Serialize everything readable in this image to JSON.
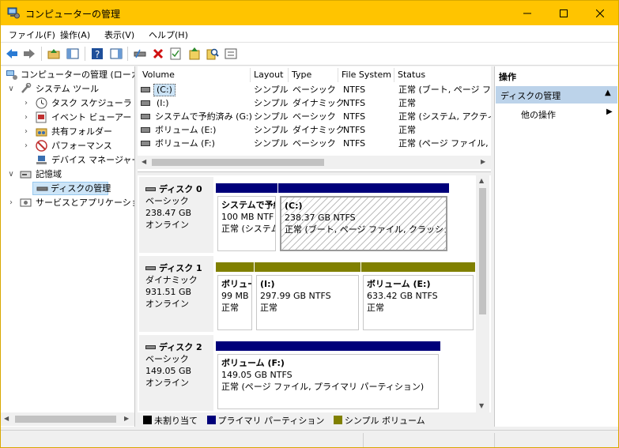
{
  "window": {
    "title": "コンピューターの管理"
  },
  "menu": {
    "file": "ファイル(F)",
    "action": "操作(A)",
    "view": "表示(V)",
    "help": "ヘルプ(H)"
  },
  "tree": {
    "root": "コンピューターの管理 (ローカル)",
    "system_tools": "システム ツール",
    "task_scheduler": "タスク スケジューラ",
    "event_viewer": "イベント ビューアー",
    "shared_folders": "共有フォルダー",
    "performance": "パフォーマンス",
    "device_manager": "デバイス マネージャー",
    "storage": "記憶域",
    "disk_management": "ディスクの管理",
    "services_apps": "サービスとアプリケーション"
  },
  "volumes": {
    "headers": [
      "Volume",
      "Layout",
      "Type",
      "File System",
      "Status"
    ],
    "rows": [
      [
        "(C:)",
        "シンプル",
        "ベーシック",
        "NTFS",
        "正常 (ブート, ページ ファイ"
      ],
      [
        "(I:)",
        "シンプル",
        "ダイナミック",
        "NTFS",
        "正常"
      ],
      [
        "システムで予約済み (G:)",
        "シンプル",
        "ベーシック",
        "NTFS",
        "正常 (システム, アクティブ"
      ],
      [
        "ボリューム (E:)",
        "シンプル",
        "ダイナミック",
        "NTFS",
        "正常"
      ],
      [
        "ボリューム (F:)",
        "シンプル",
        "ベーシック",
        "NTFS",
        "正常 (ページ ファイル, プラ"
      ]
    ]
  },
  "disks": [
    {
      "name": "ディスク 0",
      "type": "ベーシック",
      "size": "238.47 GB",
      "state": "オンライン",
      "partitions": [
        {
          "title": "システムで予約",
          "size": "100 MB NTF",
          "status": "正常 (システム"
        },
        {
          "title": "(C:)",
          "size": "238.37 GB NTFS",
          "status": "正常 (ブート, ページ ファイル, クラッシュ ダン"
        }
      ]
    },
    {
      "name": "ディスク 1",
      "type": "ダイナミック",
      "size": "931.51 GB",
      "state": "オンライン",
      "partitions": [
        {
          "title": "ボリュー",
          "size": "99 MB",
          "status": "正常"
        },
        {
          "title": "(I:)",
          "size": "297.99 GB NTFS",
          "status": "正常"
        },
        {
          "title": "ボリューム (E:)",
          "size": "633.42 GB NTFS",
          "status": "正常"
        }
      ]
    },
    {
      "name": "ディスク 2",
      "type": "ベーシック",
      "size": "149.05 GB",
      "state": "オンライン",
      "partitions": [
        {
          "title": "ボリューム (F:)",
          "size": "149.05 GB NTFS",
          "status": "正常 (ページ ファイル, プライマリ パーティション)"
        }
      ]
    }
  ],
  "legend": {
    "unallocated": "未割り当て",
    "primary": "プライマリ パーティション",
    "simple": "シンプル ボリューム"
  },
  "colors": {
    "primary": "#00007a",
    "simple": "#808000",
    "unallocated": "#000000",
    "titlebar": "#ffc400",
    "actions_header": "#bcd3ea"
  },
  "actions": {
    "header": "操作",
    "section": "ディスクの管理",
    "other": "他の操作"
  }
}
